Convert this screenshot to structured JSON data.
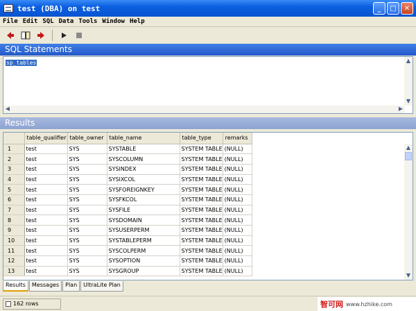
{
  "window": {
    "title": "test (DBA) on test"
  },
  "menu": [
    "File",
    "Edit",
    "SQL",
    "Data",
    "Tools",
    "Window",
    "Help"
  ],
  "toolbar": {
    "icons": [
      "back-arrow-icon",
      "open-book-icon",
      "forward-arrow-icon",
      "execute-icon",
      "stop-icon"
    ],
    "accent": "#c01818"
  },
  "sql_pane": {
    "title": "SQL Statements",
    "text": "sp_tables"
  },
  "results_pane": {
    "title": "Results"
  },
  "grid": {
    "columns": [
      "table_qualifier",
      "table_owner",
      "table_name",
      "table_type",
      "remarks"
    ],
    "rows": [
      {
        "n": "1",
        "cells": [
          "test",
          "SYS",
          "SYSTABLE",
          "SYSTEM TABLE",
          "(NULL)"
        ]
      },
      {
        "n": "2",
        "cells": [
          "test",
          "SYS",
          "SYSCOLUMN",
          "SYSTEM TABLE",
          "(NULL)"
        ]
      },
      {
        "n": "3",
        "cells": [
          "test",
          "SYS",
          "SYSINDEX",
          "SYSTEM TABLE",
          "(NULL)"
        ]
      },
      {
        "n": "4",
        "cells": [
          "test",
          "SYS",
          "SYSIXCOL",
          "SYSTEM TABLE",
          "(NULL)"
        ]
      },
      {
        "n": "5",
        "cells": [
          "test",
          "SYS",
          "SYSFOREIGNKEY",
          "SYSTEM TABLE",
          "(NULL)"
        ]
      },
      {
        "n": "6",
        "cells": [
          "test",
          "SYS",
          "SYSFKCOL",
          "SYSTEM TABLE",
          "(NULL)"
        ]
      },
      {
        "n": "7",
        "cells": [
          "test",
          "SYS",
          "SYSFILE",
          "SYSTEM TABLE",
          "(NULL)"
        ]
      },
      {
        "n": "8",
        "cells": [
          "test",
          "SYS",
          "SYSDOMAIN",
          "SYSTEM TABLE",
          "(NULL)"
        ]
      },
      {
        "n": "9",
        "cells": [
          "test",
          "SYS",
          "SYSUSERPERM",
          "SYSTEM TABLE",
          "(NULL)"
        ]
      },
      {
        "n": "10",
        "cells": [
          "test",
          "SYS",
          "SYSTABLEPERM",
          "SYSTEM TABLE",
          "(NULL)"
        ]
      },
      {
        "n": "11",
        "cells": [
          "test",
          "SYS",
          "SYSCOLPERM",
          "SYSTEM TABLE",
          "(NULL)"
        ]
      },
      {
        "n": "12",
        "cells": [
          "test",
          "SYS",
          "SYSOPTION",
          "SYSTEM TABLE",
          "(NULL)"
        ]
      },
      {
        "n": "13",
        "cells": [
          "test",
          "SYS",
          "SYSGROUP",
          "SYSTEM TABLE",
          "(NULL)"
        ]
      }
    ]
  },
  "tabs": [
    "Results",
    "Messages",
    "Plan",
    "UltraLite Plan"
  ],
  "status": {
    "rows": "162 rows"
  },
  "watermark": {
    "logo": "智可网",
    "url": "www.hzhike.com"
  }
}
